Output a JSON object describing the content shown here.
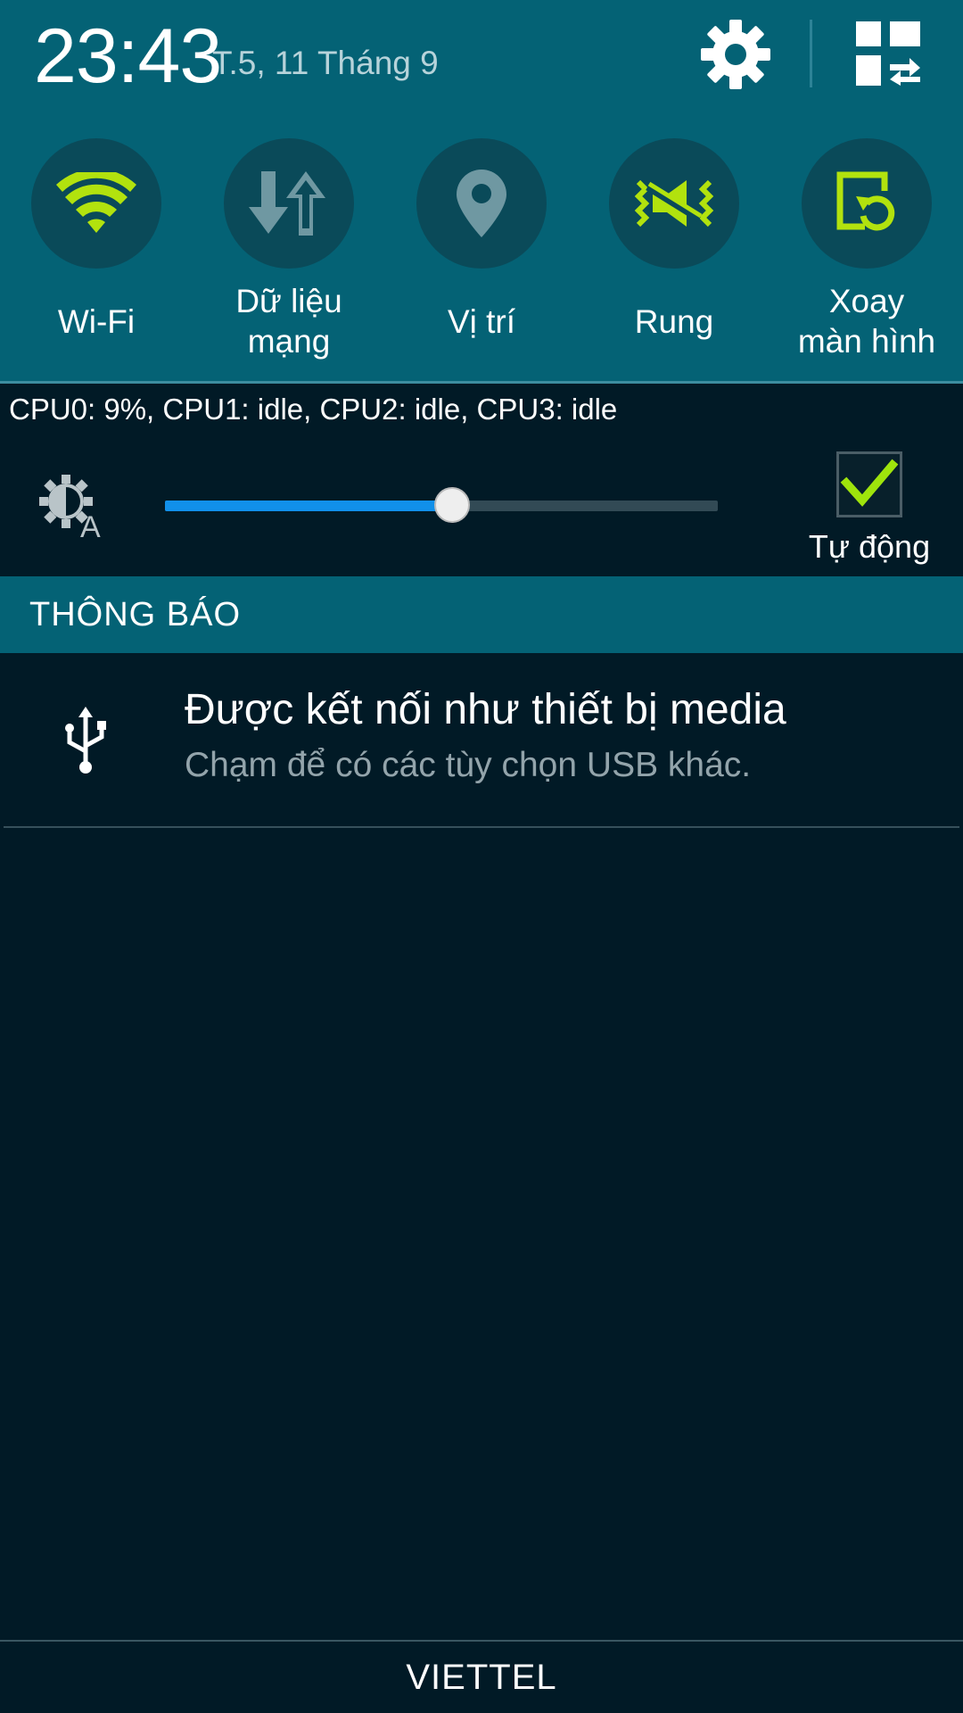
{
  "header": {
    "time": "23:43",
    "date": "T.5, 11 Tháng 9"
  },
  "icons": {
    "settings": "gear-icon",
    "edit": "grid-swap-icon"
  },
  "quick_toggles": [
    {
      "name": "wifi",
      "label_lines": [
        "Wi-Fi"
      ],
      "icon": "wifi-icon",
      "active": true,
      "color": "#b2e20e"
    },
    {
      "name": "mobile-data",
      "label_lines": [
        "Dữ liệu",
        "mạng"
      ],
      "icon": "data-arrows-icon",
      "active": false,
      "color": "#6f98a2"
    },
    {
      "name": "location",
      "label_lines": [
        "Vị trí"
      ],
      "icon": "location-pin-icon",
      "active": false,
      "color": "#6f98a2"
    },
    {
      "name": "vibrate",
      "label_lines": [
        "Rung"
      ],
      "icon": "vibrate-icon",
      "active": true,
      "color": "#b2e20e"
    },
    {
      "name": "rotate",
      "label_lines": [
        "Xoay",
        "màn hình"
      ],
      "icon": "rotate-screen-icon",
      "active": true,
      "color": "#b2e20e"
    }
  ],
  "cpu_status": "CPU0: 9%, CPU1: idle, CPU2: idle, CPU3: idle",
  "brightness": {
    "level": 0.52,
    "auto_checked": true,
    "auto_label": "Tự động"
  },
  "notifications": {
    "section_title": "THÔNG BÁO",
    "items": [
      {
        "icon": "usb-icon",
        "title": "Được kết nối như thiết bị media",
        "subtitle": "Chạm để có các tùy chọn USB khác."
      }
    ]
  },
  "carrier": "VIETTEL",
  "colors": {
    "header_bg": "#046275",
    "panel_bg": "#011a26",
    "active_icon": "#b2e20e",
    "inactive_icon": "#6f98a2",
    "slider_fill": "#1190ea"
  }
}
